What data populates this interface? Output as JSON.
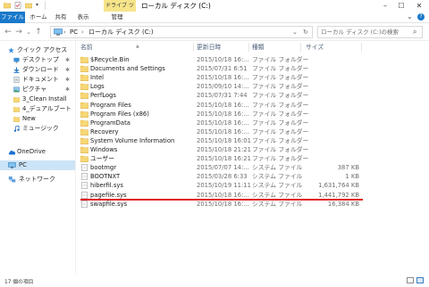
{
  "window": {
    "title": "ローカル ディスク (C:)",
    "context_tab": "ドライブ ツール",
    "minimize": "–",
    "maximize": "☐",
    "close": "✕"
  },
  "ribbon": {
    "tabs": [
      "ファイル",
      "ホーム",
      "共有",
      "表示",
      "管理"
    ],
    "expand_glyph": "⌄",
    "help_glyph": "?"
  },
  "address": {
    "back": "←",
    "forward": "→",
    "history": "⌄",
    "up": "↑",
    "segments": [
      "PC",
      "ローカル ディスク (C:)"
    ],
    "separator": "›",
    "dropdown": "⌄",
    "refresh": "↻",
    "search_placeholder": "ローカル ディスク (C:)の検索",
    "search_glyph": "⌕"
  },
  "nav": {
    "items": [
      {
        "label": "クイック アクセス",
        "icon": "star-icon",
        "pinned": false
      },
      {
        "label": "デスクトップ",
        "icon": "desktop-icon",
        "pinned": true
      },
      {
        "label": "ダウンロード",
        "icon": "download-icon",
        "pinned": true
      },
      {
        "label": "ドキュメント",
        "icon": "documents-icon",
        "pinned": true
      },
      {
        "label": "ピクチャ",
        "icon": "pictures-icon",
        "pinned": true
      },
      {
        "label": "3_Clean Install",
        "icon": "folder-icon",
        "pinned": false
      },
      {
        "label": "4_デュアルブート",
        "icon": "folder-icon",
        "pinned": false
      },
      {
        "label": "New",
        "icon": "folder-icon",
        "pinned": false
      },
      {
        "label": "ミュージック",
        "icon": "music-icon",
        "pinned": false
      },
      {
        "label": "OneDrive",
        "icon": "cloud-icon",
        "pinned": false
      },
      {
        "label": "PC",
        "icon": "pc-icon",
        "pinned": false,
        "selected": true
      },
      {
        "label": "ネットワーク",
        "icon": "network-icon",
        "pinned": false
      }
    ],
    "pin_glyph": "✱"
  },
  "columns": {
    "name": "名前",
    "date": "更新日時",
    "type": "種類",
    "size": "サイズ"
  },
  "files": [
    {
      "name": "$Recycle.Bin",
      "date": "2015/10/18 16:...",
      "type": "ファイル フォルダー",
      "size": "",
      "kind": "folder"
    },
    {
      "name": "Documents and Settings",
      "date": "2015/07/31 6:51",
      "type": "ファイル フォルダー",
      "size": "",
      "kind": "folder"
    },
    {
      "name": "Intel",
      "date": "2015/10/18 16:...",
      "type": "ファイル フォルダー",
      "size": "",
      "kind": "folder"
    },
    {
      "name": "Logs",
      "date": "2015/09/10 14:...",
      "type": "ファイル フォルダー",
      "size": "",
      "kind": "folder"
    },
    {
      "name": "PerfLogs",
      "date": "2015/07/31 7:44",
      "type": "ファイル フォルダー",
      "size": "",
      "kind": "folder"
    },
    {
      "name": "Program Files",
      "date": "2015/10/18 16:...",
      "type": "ファイル フォルダー",
      "size": "",
      "kind": "folder"
    },
    {
      "name": "Program Files (x86)",
      "date": "2015/10/18 16:...",
      "type": "ファイル フォルダー",
      "size": "",
      "kind": "folder"
    },
    {
      "name": "ProgramData",
      "date": "2015/10/18 16:...",
      "type": "ファイル フォルダー",
      "size": "",
      "kind": "folder"
    },
    {
      "name": "Recovery",
      "date": "2015/10/18 16:...",
      "type": "ファイル フォルダー",
      "size": "",
      "kind": "folder"
    },
    {
      "name": "System Volume Information",
      "date": "2015/10/18 16:01",
      "type": "ファイル フォルダー",
      "size": "",
      "kind": "folder"
    },
    {
      "name": "Windows",
      "date": "2015/10/18 21:21",
      "type": "ファイル フォルダー",
      "size": "",
      "kind": "folder"
    },
    {
      "name": "ユーザー",
      "date": "2015/10/18 16:21",
      "type": "ファイル フォルダー",
      "size": "",
      "kind": "folder"
    },
    {
      "name": "bootmgr",
      "date": "2015/07/07 14:...",
      "type": "システム ファイル",
      "size": "387 KB",
      "kind": "file"
    },
    {
      "name": "BOOTNXT",
      "date": "2015/03/28 6:33",
      "type": "システム ファイル",
      "size": "1 KB",
      "kind": "file"
    },
    {
      "name": "hiberfil.sys",
      "date": "2015/10/19 11:11",
      "type": "システム ファイル",
      "size": "1,631,764 KB",
      "kind": "file"
    },
    {
      "name": "pagefile.sys",
      "date": "2015/10/18 16:...",
      "type": "システム ファイル",
      "size": "1,441,792 KB",
      "kind": "file"
    },
    {
      "name": "swapfile.sys",
      "date": "2015/10/18 16:...",
      "type": "システム ファイル",
      "size": "16,384 KB",
      "kind": "file"
    }
  ],
  "status": {
    "item_count": "17 個の項目"
  },
  "colors": {
    "accent": "#1979ca",
    "folder": "#f8d775",
    "highlight_line": "#e21f26",
    "selected_nav": "#cce4f7",
    "context_tab": "#f6e48a"
  }
}
